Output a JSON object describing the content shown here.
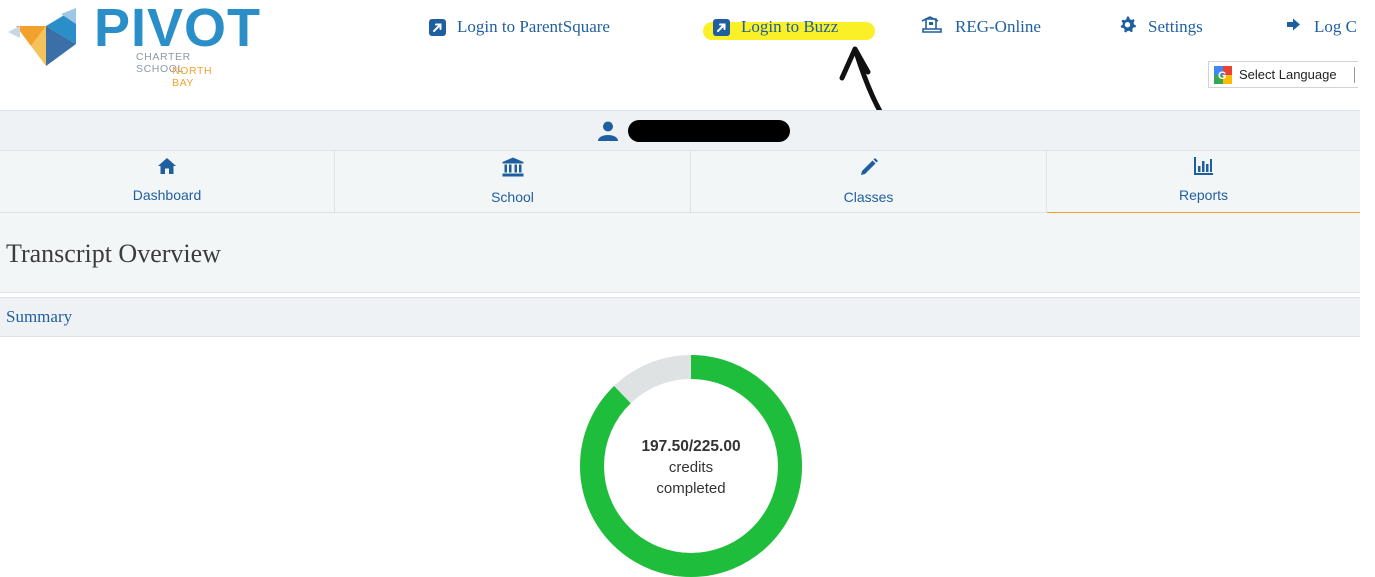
{
  "logo": {
    "word": "PIVOT",
    "line1": "CHARTER SCHOOL",
    "line2": "NORTH BAY"
  },
  "topnav": {
    "parentsquare": "Login to ParentSquare",
    "buzz": "Login to Buzz",
    "reg": "REG-Online",
    "settings": "Settings",
    "logout": "Log C"
  },
  "language": {
    "label": "Select Language"
  },
  "tabs": [
    {
      "label": "Dashboard",
      "icon": "home-icon"
    },
    {
      "label": "School",
      "icon": "bank-icon"
    },
    {
      "label": "Classes",
      "icon": "pencil-icon"
    },
    {
      "label": "Reports",
      "icon": "bar-chart-icon",
      "active": true
    }
  ],
  "page": {
    "title": "Transcript Overview",
    "summary": "Summary"
  },
  "credits": {
    "text": "197.50/225.00",
    "line2": "credits",
    "line3": "completed",
    "completed": 197.5,
    "total": 225.0
  },
  "colors": {
    "brand_blue": "#2a8ec8",
    "link_blue": "#1f5f9f",
    "accent_orange": "#f2a12e",
    "progress_green": "#1ebe3c",
    "progress_remaining": "#dfe2e3",
    "highlight": "#f9ef1c"
  }
}
